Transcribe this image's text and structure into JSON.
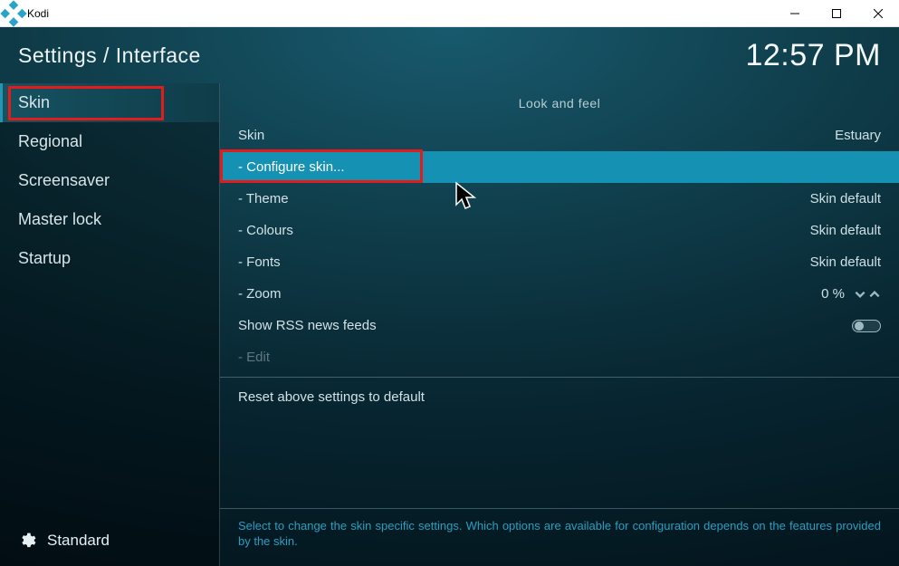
{
  "window": {
    "title": "Kodi"
  },
  "header": {
    "breadcrumb": "Settings / Interface",
    "clock": "12:57 PM"
  },
  "sidebar": {
    "items": [
      {
        "label": "Skin",
        "selected": true,
        "highlight": true
      },
      {
        "label": "Regional"
      },
      {
        "label": "Screensaver"
      },
      {
        "label": "Master lock"
      },
      {
        "label": "Startup"
      }
    ],
    "level_label": "Standard"
  },
  "content": {
    "section_title": "Look and feel",
    "rows": [
      {
        "label": "Skin",
        "value": "Estuary",
        "type": "value"
      },
      {
        "label": "- Configure skin...",
        "type": "button",
        "selected": true,
        "highlight": true
      },
      {
        "label": "- Theme",
        "value": "Skin default",
        "type": "value"
      },
      {
        "label": "- Colours",
        "value": "Skin default",
        "type": "value"
      },
      {
        "label": "- Fonts",
        "value": "Skin default",
        "type": "value"
      },
      {
        "label": "- Zoom",
        "value": "0 %",
        "type": "spinner"
      },
      {
        "label": "Show RSS news feeds",
        "type": "toggle",
        "on": false
      },
      {
        "label": "- Edit",
        "type": "button",
        "disabled": true
      },
      {
        "type": "divider"
      },
      {
        "label": "Reset above settings to default",
        "type": "button"
      }
    ],
    "help_text": "Select to change the skin specific settings. Which options are available for configuration depends on the features provided by the skin."
  }
}
